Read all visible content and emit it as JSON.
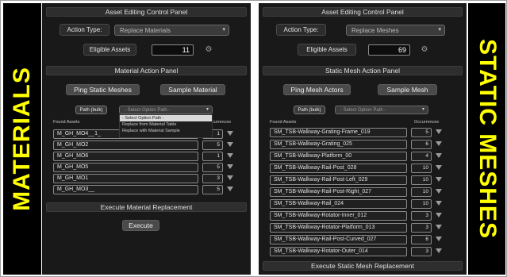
{
  "labels": {
    "left": "MATERIALS",
    "right": "STATIC MESHES"
  },
  "left": {
    "header": "Asset Editing Control Panel",
    "action_type_label": "Action Type:",
    "action_type_value": "Replace Materials",
    "eligible_label": "Eligible Assets",
    "eligible_value": "11",
    "action_panel_header": "Material Action Panel",
    "ping_button": "Ping Static Meshes",
    "sample_button": "Sample Material",
    "path_button": "Path (bulk)",
    "path_select": "- Select Option Path -",
    "dropdown_options": [
      "- Select Option Path -",
      "Replace from Material Table",
      "Replace with Material Sample"
    ],
    "found_assets_label": "Found Assets",
    "occurrences_label": "Occurrences",
    "rows": [
      {
        "name": "M_GH_MO4__1_",
        "occ": "1"
      },
      {
        "name": "M_GH_MO2",
        "occ": "5"
      },
      {
        "name": "M_GH_MO6",
        "occ": "1"
      },
      {
        "name": "M_GH_MO5",
        "occ": "5"
      },
      {
        "name": "M_GH_MO1",
        "occ": "3"
      },
      {
        "name": "M_GH_MO3__",
        "occ": "5"
      }
    ],
    "execute_header": "Execute Material Replacement",
    "execute_button": "Execute"
  },
  "right": {
    "header": "Asset Editing Control Panel",
    "action_type_label": "Action Type:",
    "action_type_value": "Replace Meshes",
    "eligible_label": "Eligible Assets",
    "eligible_value": "69",
    "action_panel_header": "Static Mesh Action Panel",
    "ping_button": "Ping Mesh Actors",
    "sample_button": "Sample Mesh",
    "path_button": "Path (bulk)",
    "path_select": "- Select Option Path -",
    "found_assets_label": "Found Assets",
    "occurrences_label": "Occurrences",
    "rows": [
      {
        "name": "SM_TSB-Walkway-Grating-Frame_019",
        "occ": "5"
      },
      {
        "name": "SM_TSB-Walkway-Grating_025",
        "occ": "6"
      },
      {
        "name": "SM_TSB-Walkway-Platform_00",
        "occ": "4"
      },
      {
        "name": "SM_TSB-Walkway-Rail-Post_028",
        "occ": "10"
      },
      {
        "name": "SM_TSB-Walkway-Rail-Post-Left_029",
        "occ": "10"
      },
      {
        "name": "SM_TSB-Walkway-Rail-Post-Right_027",
        "occ": "10"
      },
      {
        "name": "SM_TSB-Walkway-Rail_024",
        "occ": "10"
      },
      {
        "name": "SM_TSB-Walkway-Rotator-Inner_012",
        "occ": "3"
      },
      {
        "name": "SM_TSB-Walkway-Rotator-Platform_013",
        "occ": "3"
      },
      {
        "name": "SM_TSB-Walkway-Rail-Post-Curved_027",
        "occ": "6"
      },
      {
        "name": "SM_TSB-Walkway-Rotator-Outer_014",
        "occ": "3"
      }
    ],
    "execute_header": "Execute Static Mesh Replacement"
  }
}
